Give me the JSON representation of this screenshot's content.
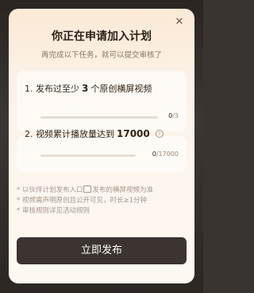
{
  "modal": {
    "title": "你正在申请加入计划",
    "subtitle": "再完成以下任务，就可以提交审核了"
  },
  "tasks": [
    {
      "prefix": "1. 发布过至少",
      "target": "3",
      "suffix": "个原创横屏视频",
      "current": "0",
      "total": "/3",
      "progress": 0
    },
    {
      "prefix": "2. 视频累计播放量达到",
      "target": "17000",
      "suffix": "",
      "current": "0",
      "total": "/17000",
      "progress": 0
    }
  ],
  "notes": {
    "line1_before": "* 以伙伴计划发布入口",
    "line1_after": "发布的横屏视频为准",
    "line2": "* 视频需声明原创且公开可见，时长≥1分钟",
    "line3": "* 审核规则详见活动规则"
  },
  "cta": {
    "label": "立即发布"
  },
  "colors": {
    "accent": "#d4b48f",
    "button": "#3b3430"
  }
}
